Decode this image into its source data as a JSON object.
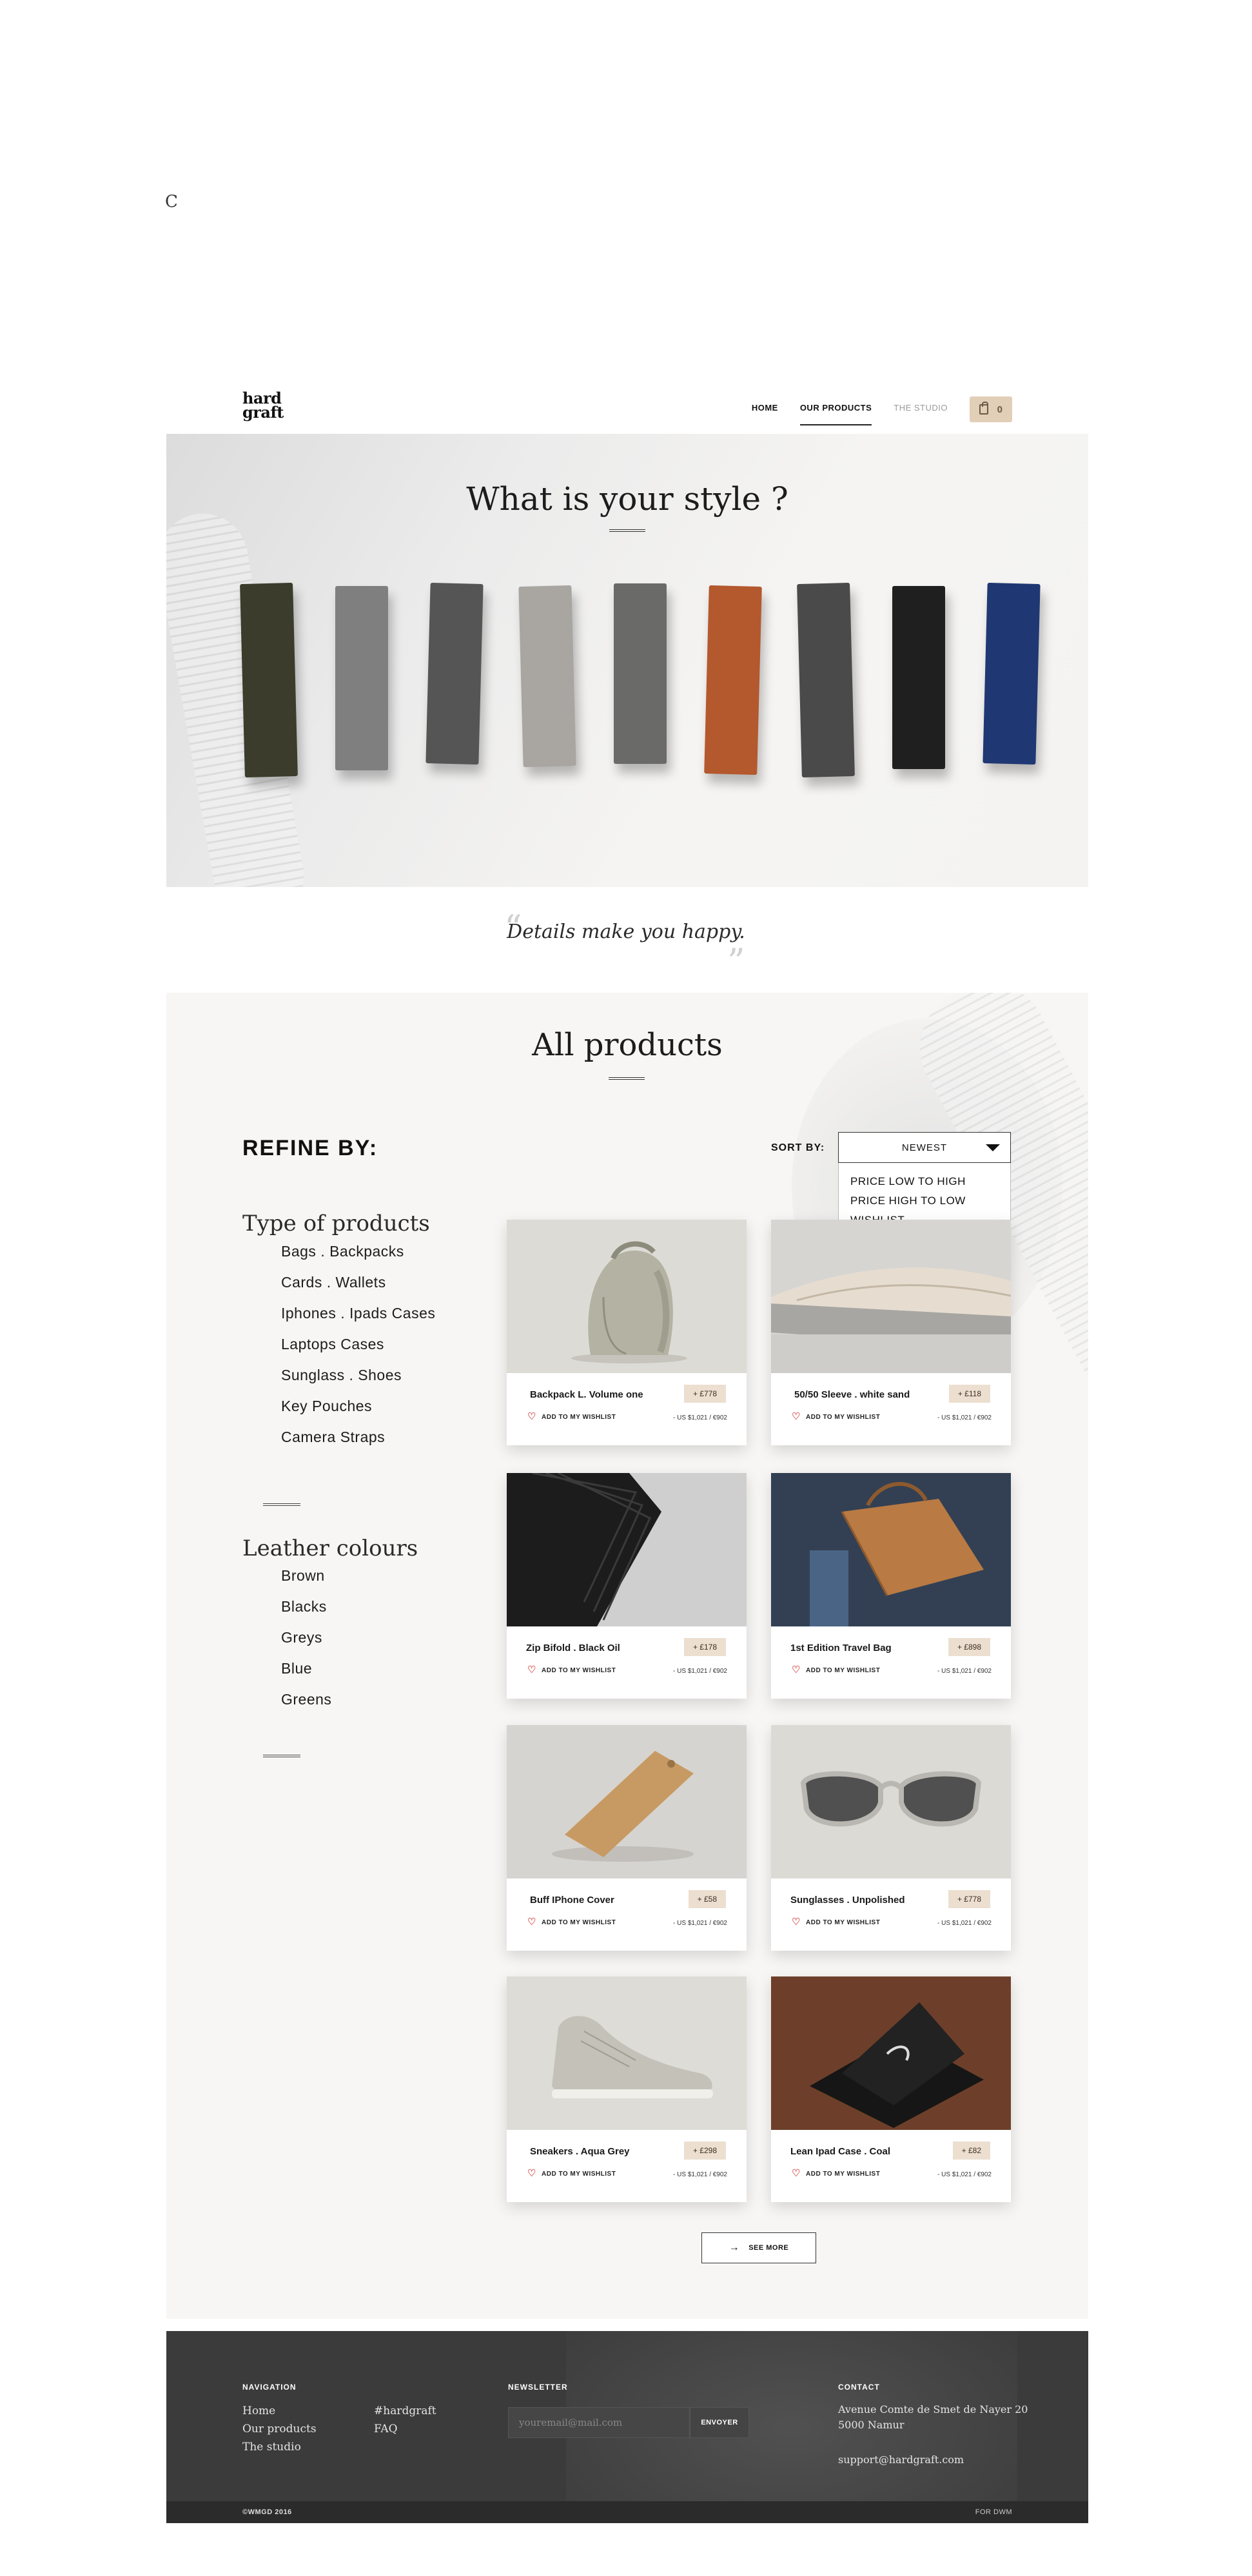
{
  "stray_letter": "C",
  "header": {
    "logo_line1": "hard",
    "logo_line2": "graft",
    "nav": {
      "home": "HOME",
      "products": "OUR PRODUCTS",
      "studio": "THE STUDIO"
    },
    "cart_count": "0"
  },
  "hero": {
    "title": "What is your style ?",
    "swatches": [
      {
        "name": "olive-canvas",
        "color": "#3b3c2c"
      },
      {
        "name": "light-grey-felt",
        "color": "#7f7f7f"
      },
      {
        "name": "dark-grey-felt",
        "color": "#555555"
      },
      {
        "name": "pale-grey-leather",
        "color": "#a9a6a1"
      },
      {
        "name": "slate-grey-leather",
        "color": "#6a6a68"
      },
      {
        "name": "brown-leather",
        "color": "#b4582e"
      },
      {
        "name": "charcoal-felt",
        "color": "#4a4a4a"
      },
      {
        "name": "black-leather",
        "color": "#1f1f1f"
      },
      {
        "name": "blue-leather",
        "color": "#1f3873"
      }
    ]
  },
  "quote": {
    "text": "Details make you happy.",
    "open": "“",
    "close": "”"
  },
  "products_section": {
    "title": "All products",
    "refine_label": "REFINE BY:",
    "sort": {
      "label": "SORT BY:",
      "selected": "NEWEST",
      "options": [
        "PRICE LOW TO HIGH",
        "PRICE HIGH TO LOW",
        "WISHLIST"
      ]
    },
    "filters": {
      "types_title": "Type of products",
      "types": [
        "Bags . Backpacks",
        "Cards . Wallets",
        "Iphones . Ipads Cases",
        "Laptops Cases",
        "Sunglass . Shoes",
        "Key Pouches",
        "Camera Straps"
      ],
      "colours_title": "Leather colours",
      "colours": [
        "Brown",
        "Blacks",
        "Greys",
        "Blue",
        "Greens"
      ]
    },
    "wishlist_label": "ADD TO MY WISHLIST",
    "products": [
      {
        "name": "Backpack L. Volume one",
        "price": "+ £778",
        "conversion": "- US $1,021 / €902",
        "icon": "backpack-image"
      },
      {
        "name": "50/50 Sleeve . white sand",
        "price": "+ £118",
        "conversion": "- US $1,021 / €902",
        "icon": "laptop-sleeve-image"
      },
      {
        "name": "Zip Bifold . Black Oil",
        "price": "+ £178",
        "conversion": "- US $1,021 / €902",
        "icon": "wallet-image"
      },
      {
        "name": "1st Edition Travel Bag",
        "price": "+ £898",
        "conversion": "- US $1,021 / €902",
        "icon": "travel-bag-image"
      },
      {
        "name": "Buff IPhone Cover",
        "price": "+ £58",
        "conversion": "- US $1,021 / €902",
        "icon": "phone-cover-image"
      },
      {
        "name": "Sunglasses . Unpolished",
        "price": "+ £778",
        "conversion": "- US $1,021 / €902",
        "icon": "sunglasses-image"
      },
      {
        "name": "Sneakers . Aqua Grey",
        "price": "+ £298",
        "conversion": "- US $1,021 / €902",
        "icon": "sneaker-image"
      },
      {
        "name": "Lean Ipad Case . Coal",
        "price": "+ £82",
        "conversion": "- US $1,021 / €902",
        "icon": "ipad-case-image"
      }
    ],
    "see_more": "SEE MORE"
  },
  "footer": {
    "navigation_title": "NAVIGATION",
    "nav_links": [
      "Home",
      "Our products",
      "The studio"
    ],
    "extra_links": [
      "#hardgraft",
      "FAQ"
    ],
    "newsletter_title": "NEWSLETTER",
    "newsletter_placeholder": "youremail@mail.com",
    "newsletter_button": "ENVOYER",
    "contact_title": "CONTACT",
    "address_line1": "Avenue Comte de Smet de Nayer 20",
    "address_line2": "5000 Namur",
    "email": "support@hardgraft.com",
    "copyright": "©WMGD 2016",
    "credit": "FOR DWM"
  },
  "colors": {
    "accent": "#e2cfb8",
    "price_tag": "#ecdfd0",
    "heart": "#e06b6b",
    "footer_bg": "#3b3b3b"
  }
}
